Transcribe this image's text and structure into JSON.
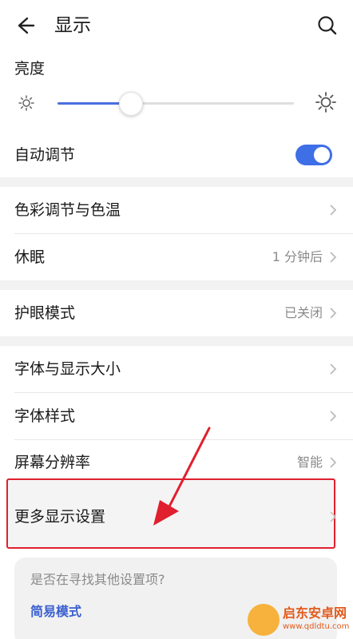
{
  "header": {
    "title": "显示",
    "back_icon": "arrow-left-icon",
    "search_icon": "search-icon"
  },
  "brightness": {
    "label": "亮度",
    "level_percent": 31,
    "icon_low": "sun-small-icon",
    "icon_high": "sun-large-icon"
  },
  "auto_adjust": {
    "label": "自动调节",
    "on": true,
    "accent": "#3f6fe6"
  },
  "rows": {
    "color_temp": {
      "label": "色彩调节与色温"
    },
    "sleep": {
      "label": "休眠",
      "value": "1 分钟后"
    },
    "eye_comfort": {
      "label": "护眼模式",
      "value": "已关闭"
    },
    "font_display_size": {
      "label": "字体与显示大小"
    },
    "font_style": {
      "label": "字体样式"
    },
    "resolution": {
      "label": "屏幕分辨率",
      "value": "智能"
    },
    "more_display": {
      "label": "更多显示设置"
    }
  },
  "suggestion": {
    "question": "是否在寻找其他设置项?",
    "link": "简易模式"
  },
  "annotation": {
    "color": "#e0202e"
  },
  "watermark": {
    "text": "启东安卓网",
    "url": "www.qdldtu.com"
  }
}
